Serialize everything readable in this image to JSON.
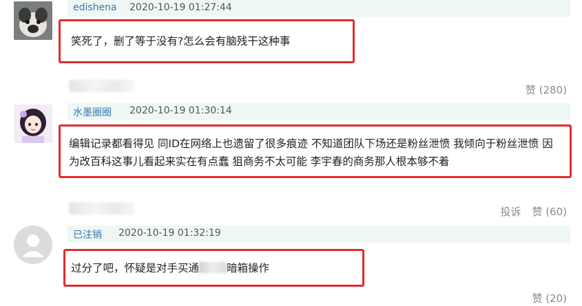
{
  "comments": [
    {
      "username": "edishena",
      "timestamp": "2020-10-19 01:27:44",
      "content": "笑死了，删了等于没有?怎么会有脑残干这种事",
      "like_label": "赞 (280)"
    },
    {
      "username": "水墨圈圈",
      "timestamp": "2020-10-19 01:30:14",
      "content": "编辑记录都看得见 同ID在网络上也遗留了很多痕迹 不知道团队下场还是粉丝泄愤 我倾向于粉丝泄愤 因为改百科这事儿看起来实在有点蠢 狙商务不太可能 李宇春的商务那人根本够不着",
      "report_label": "投诉",
      "like_label": "赞 (60)"
    },
    {
      "username": "已注销",
      "timestamp": "2020-10-19 01:32:19",
      "content": "过分了吧，怀疑是对手买通",
      "content_tail": "暗箱操作",
      "like_label": "赞 (20)"
    }
  ]
}
